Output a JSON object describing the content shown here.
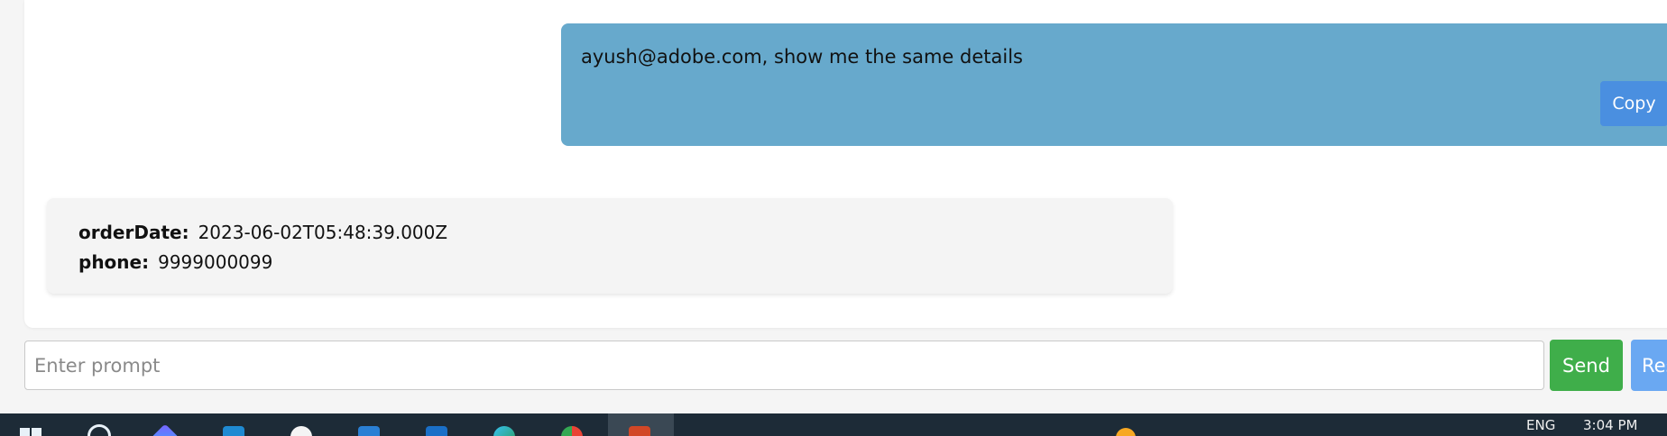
{
  "conversation": {
    "user_message": "ayush@adobe.com, show me the same details",
    "copy_label": "Copy",
    "response": [
      {
        "key": "orderDate:",
        "value": "2023-06-02T05:48:39.000Z"
      },
      {
        "key": "phone:",
        "value": "9999000099"
      }
    ]
  },
  "composer": {
    "placeholder": "Enter prompt",
    "value": "",
    "send_label": "Send",
    "reset_label": "Res"
  },
  "taskbar": {
    "language": "ENG",
    "time": "3:04 PM",
    "icons": [
      "windows-start-icon",
      "search-icon",
      "copilot-icon",
      "vscode-icon",
      "slack-icon",
      "store-icon",
      "outlook-icon",
      "edge-icon",
      "chrome-icon",
      "app-icon",
      "weather-icon"
    ]
  },
  "colors": {
    "user_bubble": "#67a9cc",
    "copy_button": "#4a8fe0",
    "send_button": "#3fae4a",
    "reset_button": "#6aa8f2",
    "taskbar": "#1d2b37"
  }
}
